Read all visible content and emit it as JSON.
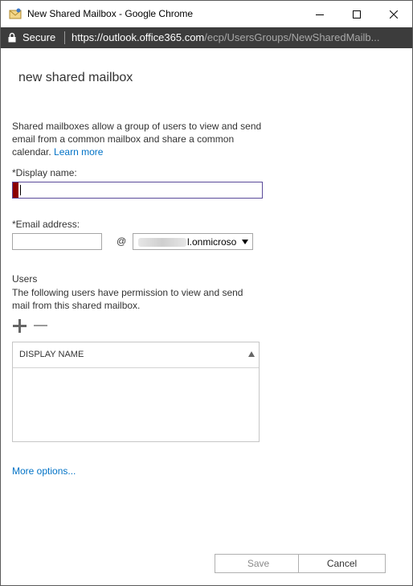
{
  "window": {
    "title": "New Shared Mailbox - Google Chrome"
  },
  "address_bar": {
    "security_label": "Secure",
    "url_scheme": "https://",
    "url_host": "outlook.office365.com",
    "url_path": "/ecp/UsersGroups/NewSharedMailb..."
  },
  "dialog": {
    "title": "new shared mailbox",
    "description": "Shared mailboxes allow a group of users to view and send email from a common mailbox and share a common calendar.",
    "learn_more_link": "Learn more",
    "display_name_label": "*Display name:",
    "display_name_value": "",
    "email_label": "*Email address:",
    "email_value": "",
    "at_sign": "@",
    "domain_value": "l.onmicroso",
    "users_heading": "Users",
    "users_description": "The following users have permission to view and send mail from this shared mailbox.",
    "users_table": {
      "columns": [
        "DISPLAY NAME"
      ],
      "rows": []
    },
    "more_options_link": "More options...",
    "save_label": "Save",
    "cancel_label": "Cancel"
  },
  "colors": {
    "link": "#0072c6",
    "address_bar_bg": "#3c3c3c",
    "error_marker": "#8c0000",
    "focus_border": "#5a4a9a"
  },
  "icons": {
    "app": "mailbox-icon",
    "lock": "lock-icon",
    "add": "plus-icon",
    "remove": "minus-icon",
    "dropdown": "triangle-down-icon",
    "sort": "triangle-up-icon"
  }
}
